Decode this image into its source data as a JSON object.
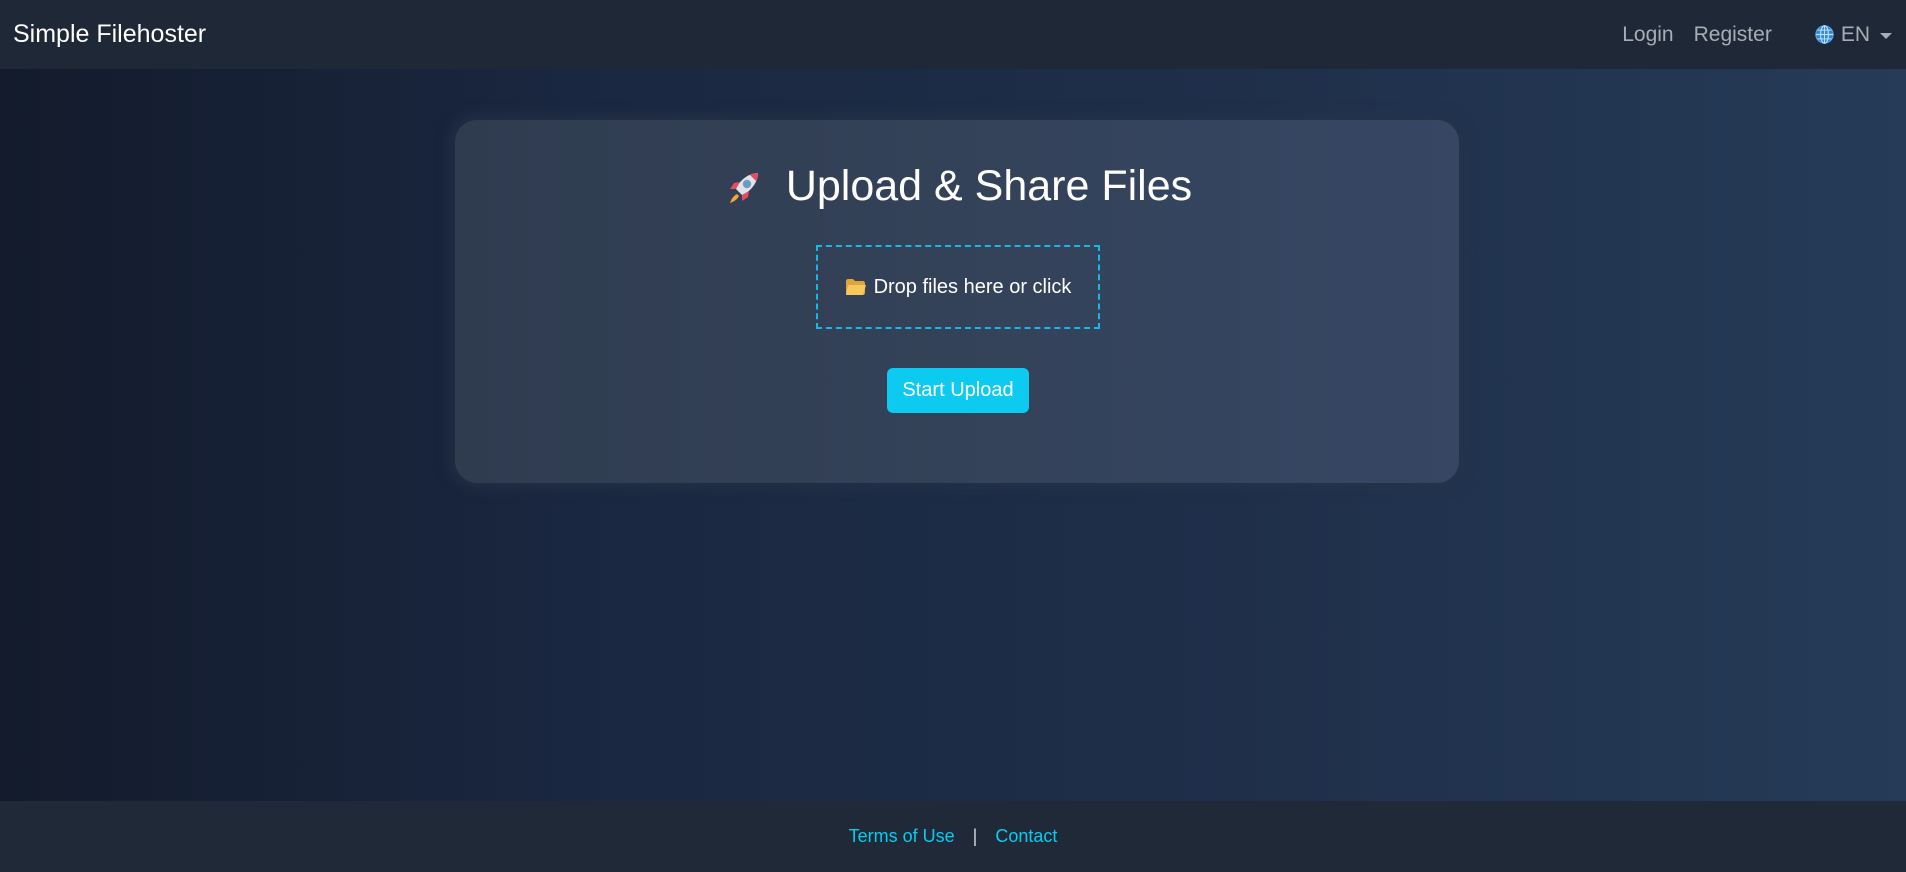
{
  "navbar": {
    "brand": "Simple Filehoster",
    "login": "Login",
    "register": "Register",
    "language": {
      "icon": "globe-icon",
      "selected": "EN"
    }
  },
  "upload": {
    "title_icon": "rocket-icon",
    "title": "Upload & Share Files",
    "dropzone_icon": "folder-icon",
    "dropzone_text": "Drop files here or click",
    "button_label": "Start Upload"
  },
  "footer": {
    "terms": "Terms of Use",
    "separator": "|",
    "contact": "Contact"
  },
  "colors": {
    "accent": "#0dcaf0",
    "navbar_bg": "#1e2836",
    "footer_bg": "#1f2937",
    "card_bg": "#344259"
  }
}
